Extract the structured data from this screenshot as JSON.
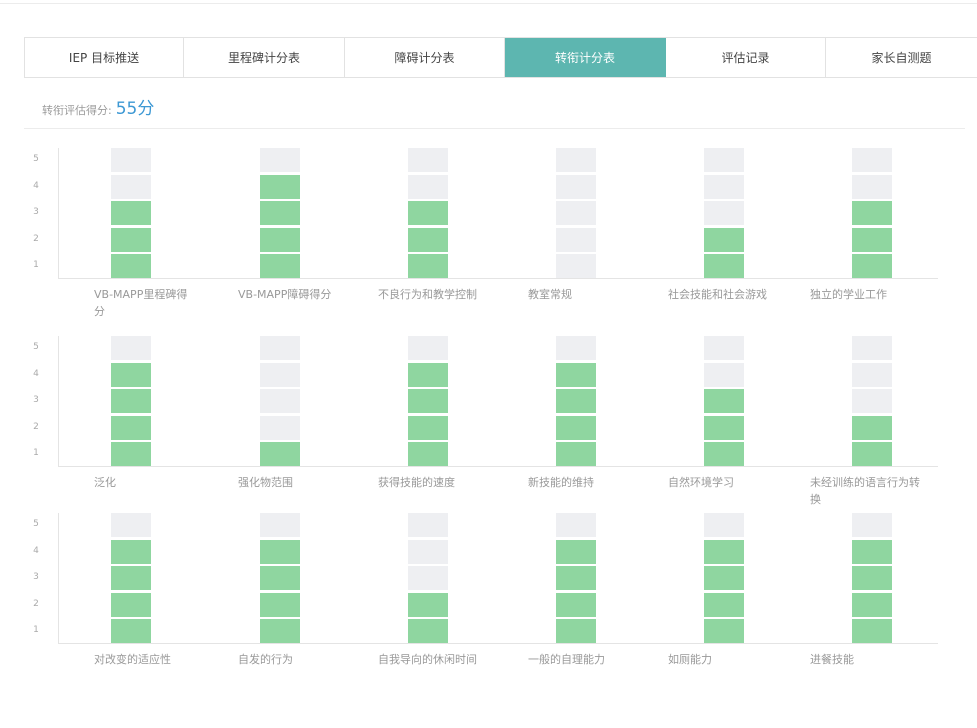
{
  "tabs": [
    {
      "label": "IEP 目标推送",
      "active": false
    },
    {
      "label": "里程碑计分表",
      "active": false
    },
    {
      "label": "障碍计分表",
      "active": false
    },
    {
      "label": "转衔计分表",
      "active": true
    },
    {
      "label": "评估记录",
      "active": false
    },
    {
      "label": "家长自测题",
      "active": false
    }
  ],
  "score": {
    "label": "转衔评估得分:",
    "value": "55分"
  },
  "colors": {
    "accent": "#5db6b0",
    "bar_fill": "#8fd6a0",
    "bar_empty": "#eeeff2",
    "score": "#3d98d4"
  },
  "chart_data": [
    {
      "type": "bar",
      "categories": [
        "VB-MAPP里程碑得分",
        "VB-MAPP障碍得分",
        "不良行为和教学控制",
        "教室常规",
        "社会技能和社会游戏",
        "独立的学业工作"
      ],
      "values": [
        3,
        4,
        3,
        0,
        2,
        3
      ],
      "y_ticks": [
        "1",
        "2",
        "3",
        "4",
        "5"
      ],
      "ylim": [
        0,
        5
      ]
    },
    {
      "type": "bar",
      "categories": [
        "泛化",
        "强化物范围",
        "获得技能的速度",
        "新技能的维持",
        "自然环境学习",
        "未经训练的语言行为转换"
      ],
      "values": [
        4,
        1,
        4,
        4,
        3,
        2
      ],
      "y_ticks": [
        "1",
        "2",
        "3",
        "4",
        "5"
      ],
      "ylim": [
        0,
        5
      ]
    },
    {
      "type": "bar",
      "categories": [
        "对改变的适应性",
        "自发的行为",
        "自我导向的休闲时间",
        "一般的自理能力",
        "如厕能力",
        "进餐技能"
      ],
      "values": [
        4,
        4,
        2,
        4,
        4,
        4
      ],
      "y_ticks": [
        "1",
        "2",
        "3",
        "4",
        "5"
      ],
      "ylim": [
        0,
        5
      ]
    }
  ]
}
